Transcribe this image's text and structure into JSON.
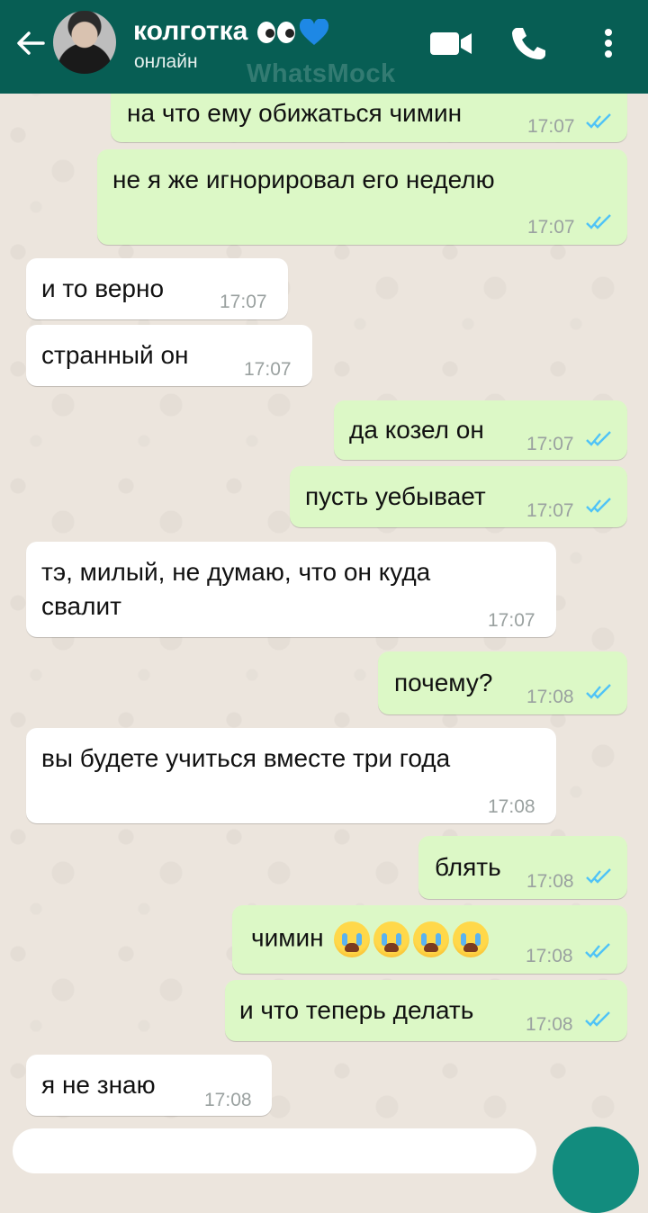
{
  "header": {
    "contact_name": "колготка",
    "contact_status": "онлайн",
    "watermark": "WhatsMock",
    "icons": [
      "back-arrow-icon",
      "avatar",
      "video-call-icon",
      "phone-icon",
      "more-vert-icon"
    ],
    "bg_color": "#075e54"
  },
  "messages": [
    {
      "dir": "out",
      "text": "на что ему обижаться чимин",
      "time": "17:07",
      "read": true
    },
    {
      "dir": "out",
      "text": "не я же игнорировал его неделю",
      "time": "17:07",
      "read": true
    },
    {
      "dir": "in",
      "text": "и то верно",
      "time": "17:07"
    },
    {
      "dir": "in",
      "text": "странный он",
      "time": "17:07"
    },
    {
      "dir": "out",
      "text": "да козел он",
      "time": "17:07",
      "read": true
    },
    {
      "dir": "out",
      "text": "пусть уебывает",
      "time": "17:07",
      "read": true
    },
    {
      "dir": "in",
      "text_line1": "тэ, милый, не думаю, что он куда",
      "text_line2": "свалит",
      "time": "17:07"
    },
    {
      "dir": "out",
      "text": "почему?",
      "time": "17:08",
      "read": true
    },
    {
      "dir": "in",
      "text": "вы будете учиться вместе три года",
      "time": "17:08"
    },
    {
      "dir": "out",
      "text": "блять",
      "time": "17:08",
      "read": true
    },
    {
      "dir": "out",
      "text": "чимин",
      "emoji": "loudly-crying-face x4",
      "time": "17:08",
      "read": true
    },
    {
      "dir": "out",
      "text": "и что теперь делать",
      "time": "17:08",
      "read": true
    },
    {
      "dir": "in",
      "text": "я не знаю",
      "time": "17:08"
    }
  ],
  "colors": {
    "outgoing": "#dcf8c6",
    "incoming": "#ffffff",
    "read_ticks": "#4fc3f7",
    "accent": "#128c7e"
  }
}
